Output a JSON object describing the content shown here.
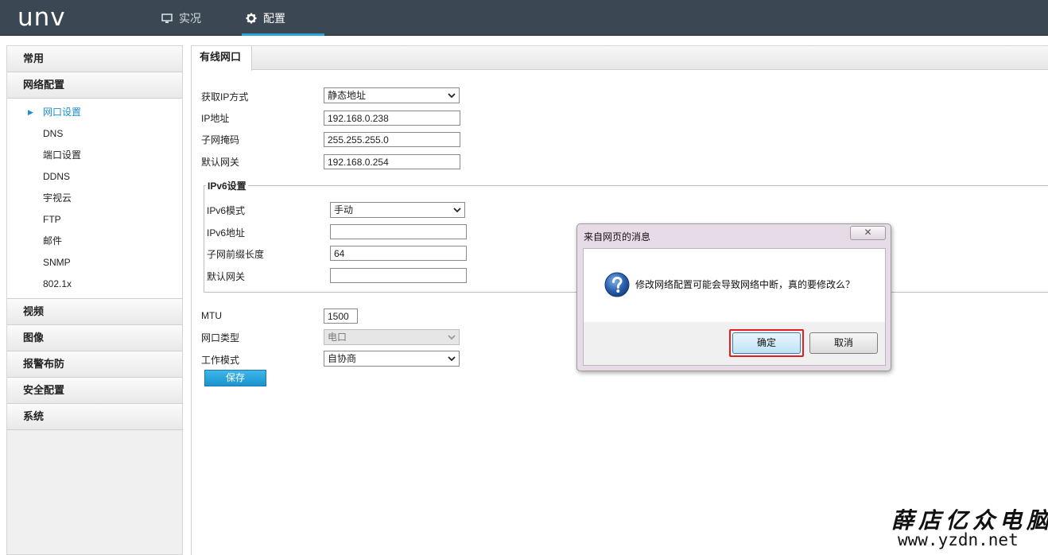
{
  "header": {
    "logo": "UNV",
    "tabs": [
      {
        "label": "实况",
        "icon": "monitor-icon"
      },
      {
        "label": "配置",
        "icon": "gear-icon"
      }
    ]
  },
  "sidebar": {
    "groups": [
      {
        "label": "常用"
      },
      {
        "label": "网络配置"
      },
      {
        "label": "视频"
      },
      {
        "label": "图像"
      },
      {
        "label": "报警布防"
      },
      {
        "label": "安全配置"
      },
      {
        "label": "系统"
      }
    ],
    "network_items": [
      "网口设置",
      "DNS",
      "端口设置",
      "DDNS",
      "宇视云",
      "FTP",
      "邮件",
      "SNMP",
      "802.1x"
    ],
    "active_item": "网口设置"
  },
  "tabs": {
    "wired": "有线网口"
  },
  "form": {
    "ip_mode_label": "获取IP方式",
    "ip_mode_value": "静态地址",
    "ip_label": "IP地址",
    "ip_value": "192.168.0.238",
    "mask_label": "子网掩码",
    "mask_value": "255.255.255.0",
    "gateway_label": "默认网关",
    "gateway_value": "192.168.0.254",
    "ipv6": {
      "legend": "IPv6设置",
      "mode_label": "IPv6模式",
      "mode_value": "手动",
      "addr_label": "IPv6地址",
      "addr_value": "",
      "prefix_label": "子网前缀长度",
      "prefix_value": "64",
      "gateway_label": "默认网关",
      "gateway_value": ""
    },
    "mtu_label": "MTU",
    "mtu_value": "1500",
    "port_type_label": "网口类型",
    "port_type_value": "电口",
    "work_mode_label": "工作模式",
    "work_mode_value": "自协商",
    "save_label": "保存"
  },
  "dialog": {
    "title": "来自网页的消息",
    "close": "✕",
    "message": "修改网络配置可能会导致网络中断，真的要修改么？",
    "ok": "确定",
    "cancel": "取消"
  },
  "watermark": {
    "line1": "薛店亿众电脑",
    "line2": "www.yzdn.net"
  }
}
